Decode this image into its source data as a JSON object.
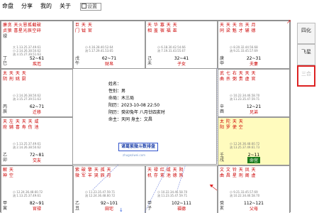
{
  "menu": {
    "items": [
      "命盘",
      "分享",
      "我的",
      "关于"
    ],
    "field_value": "设置"
  },
  "panel": {
    "tabs": [
      "四化",
      "飞星",
      "三合"
    ]
  },
  "cells": [
    {
      "stars1": "廉贪 天火恩孤截破",
      "stars2": "贞狼 喜星光辰空碎",
      "stars3": "禄",
      "mini": [
        "大 1.13.25.37.49.61",
        "小 2.14.26.38.50.62",
        "流 3.15.27.39.51.63"
      ],
      "gz": "丁巳",
      "age": "52~61",
      "dom": "疾厄",
      "hl": false
    },
    {
      "stars1": "巨 天 天",
      "stars2": "门 钺 官",
      "stars3": "",
      "mini": [
        "小 4.16.28.40.52.64",
        "流 5.17.29.41.53.65",
        ""
      ],
      "gz": "戊午",
      "age": "62~71",
      "dom": "财帛",
      "hl": false
    },
    {
      "stars1": "天 华 寡 天 天",
      "stars2": "相 盖 宿 福 巫",
      "stars3": "",
      "mini": [
        "小 6.18.30.42.54.66",
        "流 7.19.31.43.55.67",
        ""
      ],
      "gz": "己未",
      "age": "32~41",
      "dom": "子女",
      "hl": false
    },
    {
      "stars1": "天 天 天 台 天 月",
      "stars2": "同 梁 魁 才 辅 德",
      "stars3": "",
      "mini": [
        "小 8.20.32.44.56.68",
        "流 9.21.33.45.57.69",
        ""
      ],
      "gz": "庚申",
      "age": "22~31",
      "dom": "夫妻",
      "hl": false
    },
    {
      "stars1": "太 天 天 天",
      "stars2": "阴 刑 姚 厨",
      "stars3": "",
      "mini": [
        "小 2.14.26.38.50.62",
        "流 3.15.27.39.51.63",
        ""
      ],
      "gz": "丙辰",
      "age": "62~71",
      "dom": "迁移",
      "hl": false
    },
    {
      "stars1": "武 七 右 天 天 天",
      "stars2": "曲 杀 弼 贵 虚 官",
      "stars3": "",
      "mini": [
        "小 10.22.34.46.58.70",
        "流 11.23.35.47.59.71",
        ""
      ],
      "gz": "辛酉",
      "age": "12~21",
      "dom": "兄弟",
      "hl": false
    },
    {
      "stars1": "天 左 天 天 天 咸",
      "stars2": "府 辅 喜 寿 伤 池",
      "stars3": "",
      "mini": [
        "小 1.13.25.37.49.61",
        "流 2.14.26.38.50.62",
        ""
      ],
      "gz": "乙卯",
      "age": "72~81",
      "dom": "交友",
      "hl": false
    },
    {
      "stars1": "太 陀 天 天",
      "stars2": "阳 罗 使 空",
      "stars3": "",
      "mini": [
        "小 12.24.36.48.60.72",
        "流 13.25.37.49.61.73",
        ""
      ],
      "gz": "壬戌",
      "age": "2~11",
      "dom": "命宫",
      "hl": true
    },
    {
      "stars1": "解 天",
      "stars2": "神 空",
      "stars3": "",
      "mini": [
        "小 12.24.36.48.60.72",
        "流 1.13.25.37.49.61",
        ""
      ],
      "gz": "甲寅",
      "age": "82~91",
      "dom": "官禄",
      "hl": false
    },
    {
      "stars1": "紫 破 擎 天 孤 天",
      "stars2": "微 军 羊 哭 辰 月",
      "stars3": "",
      "mini": [
        "小 11.23.35.47.59.71",
        "流 12.24.36.48.60.72",
        ""
      ],
      "gz": "乙丑",
      "age": "92~101",
      "dom": "田宅",
      "hl": false
    },
    {
      "stars1": "天 禄 红 咸 天 阴",
      "stars2": "机 存 鸾 池 德 煞",
      "stars3": "",
      "mini": [
        "小 10.22.34.46.58.70",
        "流 11.23.35.47.59.71",
        ""
      ],
      "gz": "甲子",
      "age": "102~111",
      "dom": "福德",
      "hl": false
    },
    {
      "stars1": "文 文 铃 天 凤 天",
      "stars2": "曲 昌 星 刑 阁 虚",
      "stars3": "",
      "mini": [
        "小 9.21.33.45.57.69",
        "流 10.22.34.46.58.70",
        ""
      ],
      "gz": "癸亥",
      "age": "112~121",
      "dom": "父母",
      "hl": false
    }
  ],
  "center": {
    "lines": [
      "姓名：",
      "性别：男",
      "命局：木三局",
      "阳历：2023-10-08 22:50",
      "阴历：癸卯兔年 八月廿四亥时",
      "命主：天同 身主：文昌"
    ],
    "brand": "诸葛紫微斗数排盘",
    "url": "zhugeziwei.com"
  }
}
